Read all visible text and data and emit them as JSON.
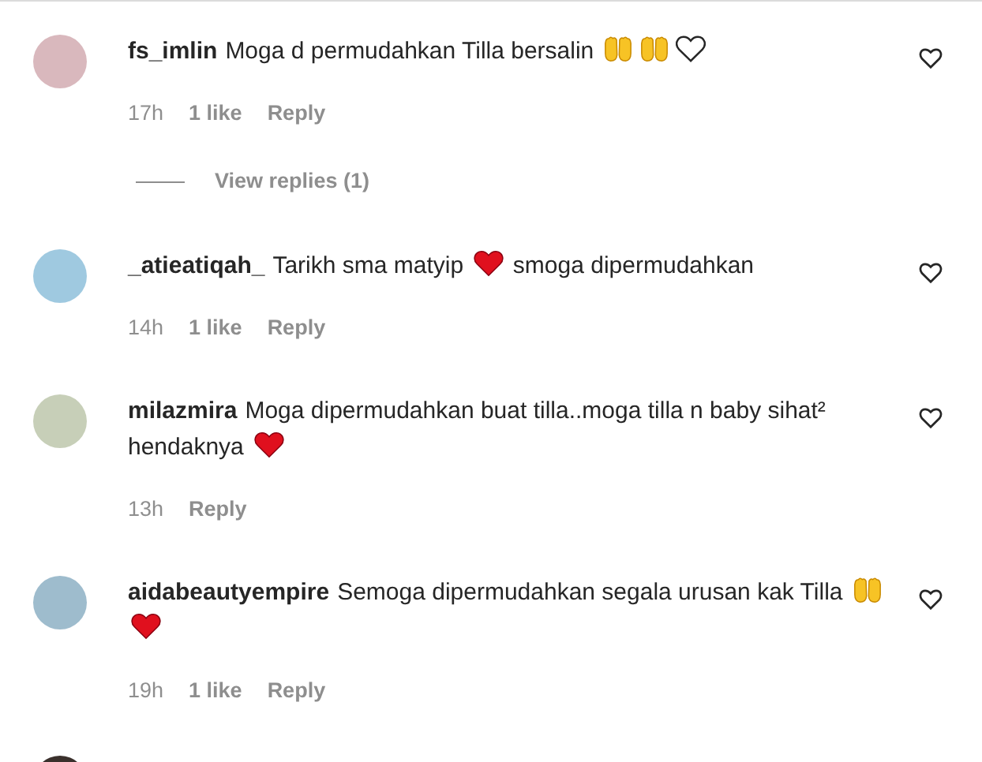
{
  "comments": [
    {
      "username": "fs_imlin",
      "body": [
        {
          "kind": "text",
          "text": "Moga d permudahkan Tilla bersalin"
        },
        {
          "kind": "palms"
        },
        {
          "kind": "palms"
        },
        {
          "kind": "white-heart"
        }
      ],
      "time": "17h",
      "likes": "1 like",
      "reply": "Reply",
      "view_replies": "View replies (1)"
    },
    {
      "username": "_atieatiqah_",
      "body": [
        {
          "kind": "text",
          "text": "Tarikh sma matyip"
        },
        {
          "kind": "red-heart"
        },
        {
          "kind": "text",
          "text": "smoga dipermudahkan"
        }
      ],
      "time": "14h",
      "likes": "1 like",
      "reply": "Reply"
    },
    {
      "username": "milazmira",
      "body": [
        {
          "kind": "text",
          "text": "Moga dipermudahkan buat tilla..moga tilla n baby sihat² hendaknya"
        },
        {
          "kind": "red-heart"
        }
      ],
      "time": "13h",
      "reply": "Reply"
    },
    {
      "username": "aidabeautyempire",
      "body": [
        {
          "kind": "text",
          "text": "Semoga dipermudahkan segala urusan kak Tilla"
        },
        {
          "kind": "palms"
        },
        {
          "kind": "red-heart"
        }
      ],
      "time": "19h",
      "likes": "1 like",
      "reply": "Reply"
    }
  ]
}
